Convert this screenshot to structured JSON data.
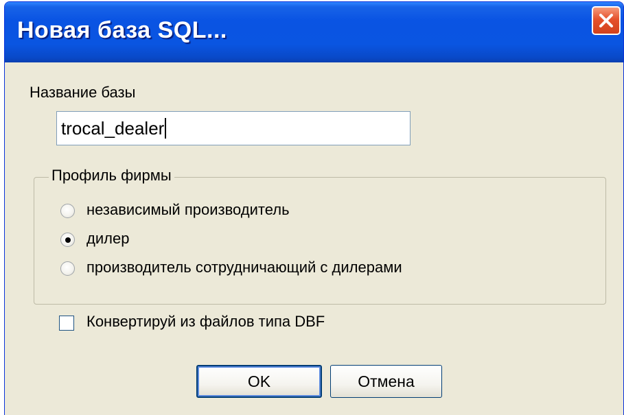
{
  "window": {
    "title": "Новая база SQL...",
    "title_bar_color": "#0a54e3",
    "close_icon": "close-x-icon"
  },
  "db_name": {
    "label": "Название базы",
    "value": "trocal_dealer"
  },
  "firm_profile": {
    "legend": "Профиль фирмы",
    "options": [
      {
        "label": "независимый производитель",
        "selected": false
      },
      {
        "label": "дилер",
        "selected": true
      },
      {
        "label": "производитель сотрудничающий с дилерами",
        "selected": false
      }
    ]
  },
  "convert": {
    "label": "Конвертируй из файлов типа DBF",
    "checked": false
  },
  "buttons": {
    "ok_label": "OK",
    "cancel_label": "Отмена"
  }
}
